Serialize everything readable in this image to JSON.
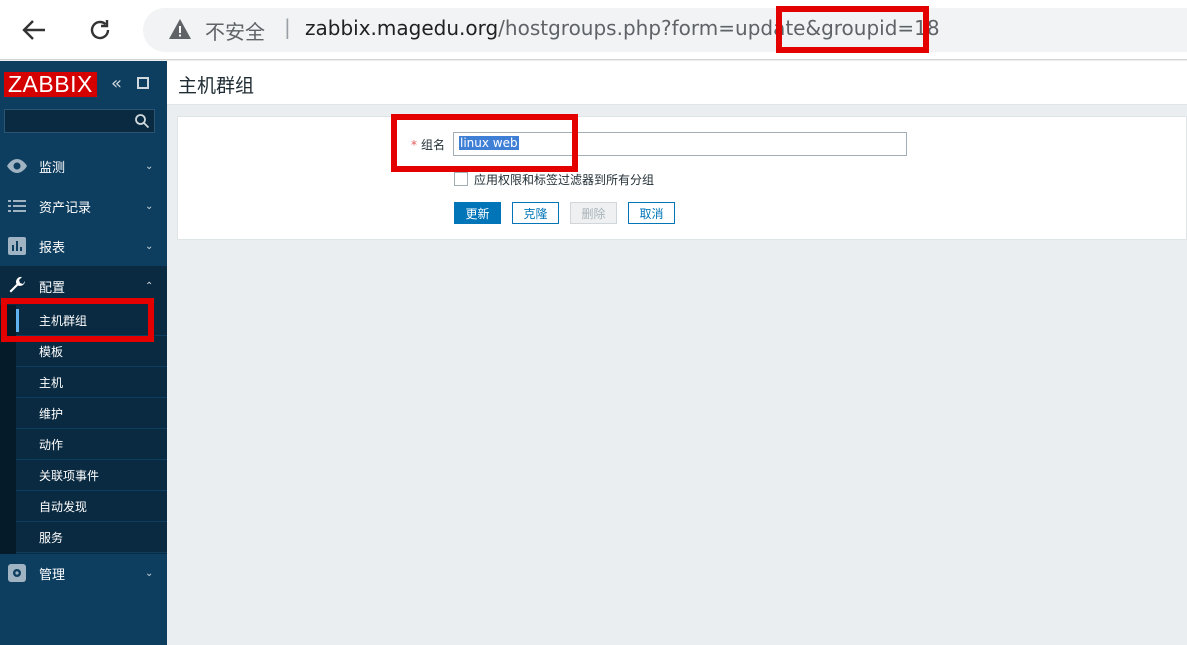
{
  "browser": {
    "insecure_label": "不安全",
    "separator": "|",
    "url_host": "zabbix.magedu.org",
    "url_path": "/hostgroups.php?form=update&groupid=18"
  },
  "sidebar": {
    "logo": "ZABBIX",
    "menu": {
      "monitoring": "监测",
      "inventory": "资产记录",
      "reports": "报表",
      "configuration": "配置",
      "administration": "管理"
    },
    "submenu": [
      {
        "label": "主机群组"
      },
      {
        "label": "模板"
      },
      {
        "label": "主机"
      },
      {
        "label": "维护"
      },
      {
        "label": "动作"
      },
      {
        "label": "关联项事件"
      },
      {
        "label": "自动发现"
      },
      {
        "label": "服务"
      }
    ]
  },
  "page": {
    "title": "主机群组"
  },
  "form": {
    "required_mark": "*",
    "name_label": "组名",
    "name_value": "linux web",
    "apply_label": "应用权限和标签过滤器到所有分组",
    "buttons": {
      "update": "更新",
      "clone": "克隆",
      "delete": "删除",
      "cancel": "取消"
    }
  },
  "colors": {
    "sidebar_bg": "#0e3e5f",
    "logo_bg": "#d40000",
    "primary_button": "#0275b8",
    "highlight_box": "#e50000"
  }
}
